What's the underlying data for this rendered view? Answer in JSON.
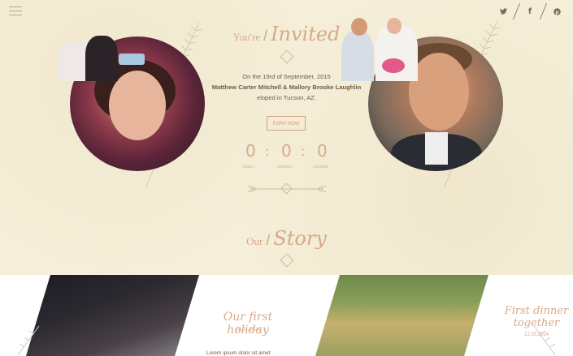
{
  "top_bar": {
    "menu_icon": "hamburger-icon",
    "social": [
      {
        "name": "twitter",
        "glyph": "𝕋"
      },
      {
        "name": "facebook",
        "glyph": "f"
      },
      {
        "name": "pinterest",
        "glyph": "℘"
      }
    ]
  },
  "invite": {
    "prefix": "You're",
    "script_word": "Invited",
    "date_line": "On the 19rd of September, 2015",
    "names": "Matthew Carter Mitchell & Mallory Brooke Laughlin",
    "place_line": "eloped in Tucson, AZ.",
    "rsvp_label": "RSRP NOW"
  },
  "countdown": {
    "hours": "0",
    "minutes": "0",
    "seconds": "0",
    "separator": ":",
    "hours_label": "hours",
    "minutes_label": "minutes",
    "seconds_label": "seconds"
  },
  "story": {
    "prefix": "Our",
    "script_word": "Story",
    "items": [
      {
        "title": "Our first holiday",
        "date": "09.01.2014",
        "excerpt": "Lorem ipsum dolor sit amet"
      },
      {
        "title": "First dinner together",
        "date": "12.03.2014"
      }
    ]
  },
  "colors": {
    "background": "#f6f0dc",
    "accent": "#d9a88a",
    "text": "#6f5a48"
  }
}
